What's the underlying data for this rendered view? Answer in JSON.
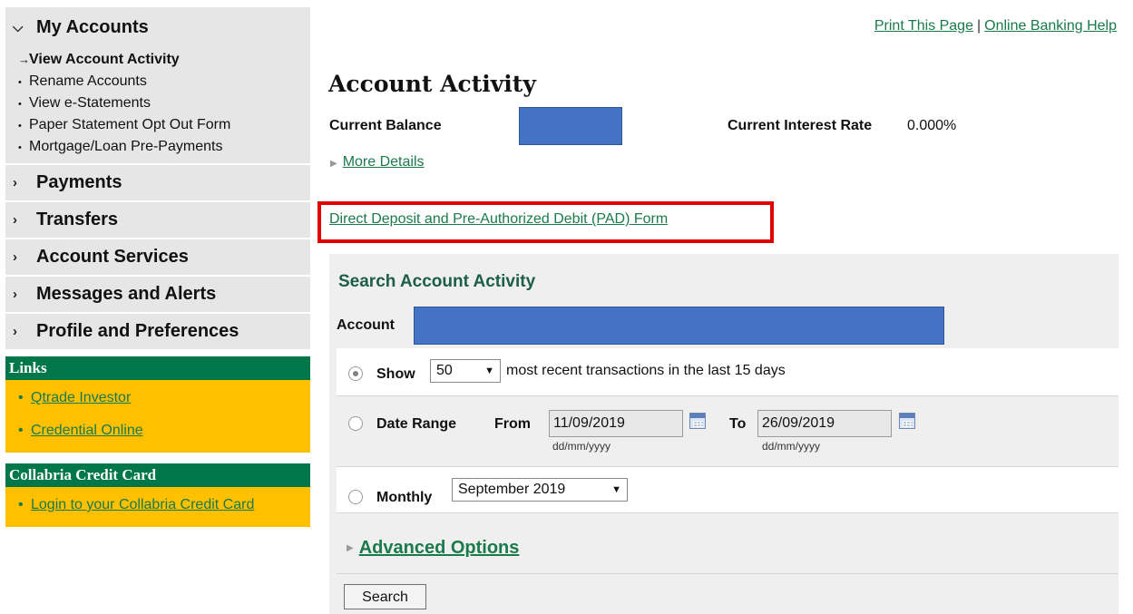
{
  "sidebar": {
    "my_accounts": "My Accounts",
    "sub_items": [
      "View Account Activity",
      "Rename Accounts",
      "View e-Statements",
      "Paper Statement Opt Out Form",
      "Mortgage/Loan Pre-Payments"
    ],
    "menu": [
      "Payments",
      "Transfers",
      "Account Services",
      "Messages and Alerts",
      "Profile and Preferences"
    ],
    "links_title": "Links",
    "links": [
      "Qtrade Investor",
      "Credential Online"
    ],
    "card_title": "Collabria Credit Card",
    "card_links": [
      "Login to your Collabria Credit Card"
    ]
  },
  "top_links": {
    "print": "Print This Page",
    "separator": "|",
    "help": "Online Banking Help"
  },
  "page": {
    "title": "Account Activity",
    "current_balance_label": "Current Balance",
    "interest_label": "Current Interest Rate",
    "interest_value": "0.000%",
    "more_details": "More Details",
    "pad_link": "Direct Deposit and Pre-Authorized Debit (PAD) Form"
  },
  "search": {
    "title": "Search Account Activity",
    "account_label": "Account",
    "show_label": "Show",
    "show_value": "50",
    "show_suffix": "most recent transactions in the last 15 days",
    "date_range_label": "Date Range",
    "from_label": "From",
    "from_value": "11/09/2019",
    "to_label": "To",
    "to_value": "26/09/2019",
    "date_hint": "dd/mm/yyyy",
    "monthly_label": "Monthly",
    "monthly_value": "September 2019",
    "advanced": "Advanced Options",
    "button": "Search"
  },
  "colors": {
    "nav_bg": "#e6e6e6",
    "box_header": "#00774a",
    "box_bg": "#ffc000",
    "link": "#1a7a4c",
    "redaction": "#4472c4",
    "highlight_border": "#e00000"
  }
}
